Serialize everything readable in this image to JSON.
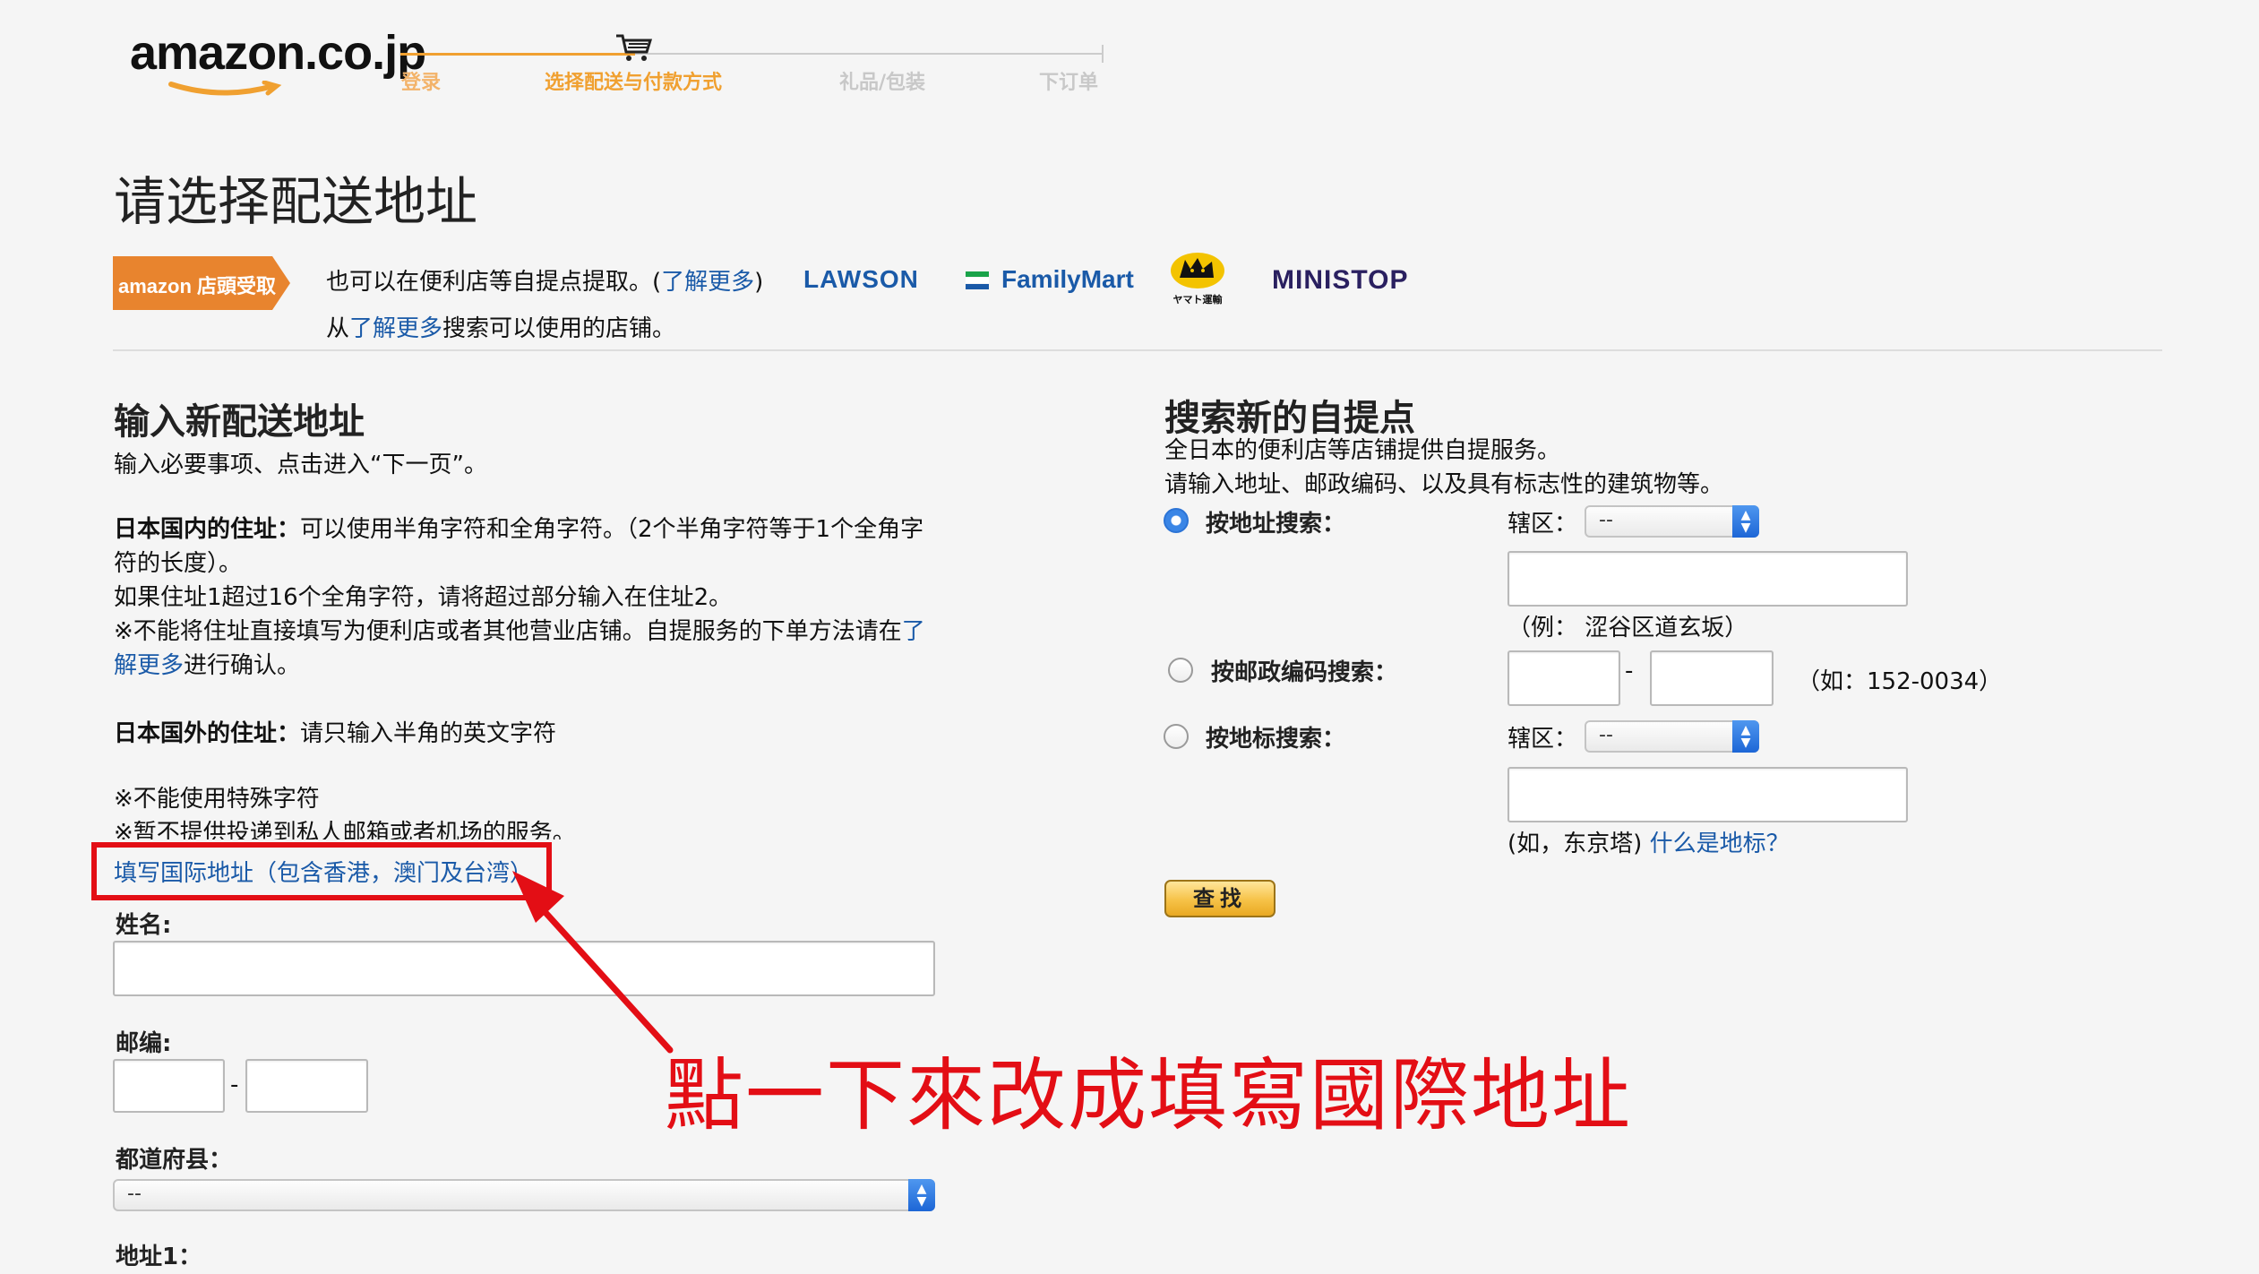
{
  "header": {
    "logo_text": "amazon.co.jp",
    "steps": [
      "登录",
      "选择配送与付款方式",
      "礼品/包装",
      "下订单"
    ],
    "active_color": "#f0a030"
  },
  "page_title": "请选择配送地址",
  "pickup": {
    "badge": "amazon 店頭受取",
    "desc_line1_prefix": "也可以在便利店等自提点提取。(",
    "desc_line1_link": "了解更多",
    "desc_line1_suffix": ")",
    "desc_line2_prefix": "从",
    "desc_line2_link": "了解更多",
    "desc_line2_suffix": "搜索可以使用的店铺。",
    "stores": {
      "lawson": "LAWSON",
      "familymart": "FamilyMart",
      "yamato_caption": "ヤマト運輸",
      "ministop": "MINISTOP"
    }
  },
  "left": {
    "heading": "输入新配送地址",
    "intro": "输入必要事项、点击进入“下一页”。",
    "domestic_title": "日本国内的住址：",
    "domestic_text": "可以使用半角字符和全角字符。（2个半角字符等于1个全角字符的长度）。",
    "domestic_line2": "如果住址1超过16个全角字符，请将超过部分输入在住址2。",
    "domestic_line3_prefix": "※不能将住址直接填写为便利店或者其他营业店铺。自提服务的下单方法请在",
    "domestic_line3_link": "了解更多",
    "domestic_line3_suffix": "进行确认。",
    "foreign_title": "日本国外的住址：",
    "foreign_text": "请只输入半角的英文字符",
    "note1": "※不能使用特殊字符",
    "note2": "※暂不提供投递到私人邮箱或者机场的服务。",
    "intl_link": "填写国际地址（包含香港，澳门及台湾）",
    "name_label": "姓名:",
    "postal_label": "邮编:",
    "postal_dash": "-",
    "prefecture_label": "都道府县：",
    "prefecture_value": "--",
    "address1_label": "地址1："
  },
  "right": {
    "heading": "搜索新的自提点",
    "desc1": "全日本的便利店等店铺提供自提服务。",
    "desc2": "请输入地址、邮政编码、以及具有标志性的建筑物等。",
    "opt_address": "按地址搜索：",
    "opt_postal": "按邮政编码搜索：",
    "opt_landmark": "按地标搜索：",
    "district_label": "辖区：",
    "district_value": "--",
    "address_example": "（例： 涩谷区道玄坂）",
    "postal_dash": "-",
    "postal_example": "（如：152-0034）",
    "landmark_example_prefix": "(如，东京塔)",
    "landmark_example_link": "什么是地标？",
    "search_button": "查找"
  },
  "annotation": {
    "text": "點一下來改成填寫國際地址",
    "color": "#e30e15"
  }
}
